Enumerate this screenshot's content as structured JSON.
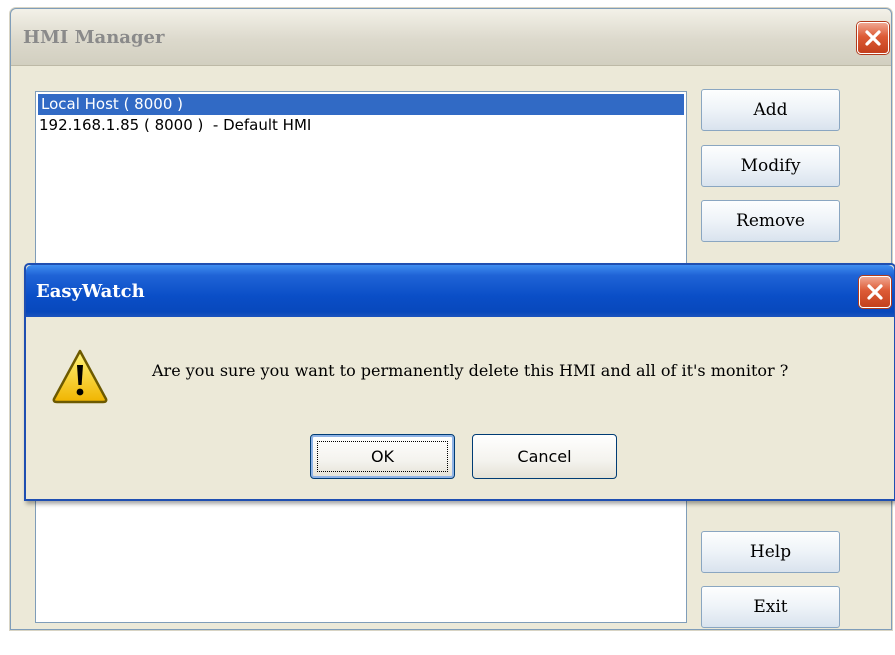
{
  "window": {
    "title": "HMI Manager",
    "close_icon": "close-icon"
  },
  "hmi_list": {
    "items": [
      {
        "label": "Local Host ( 8000 )",
        "selected": true
      },
      {
        "label": "192.168.1.85 ( 8000 )  - Default HMI",
        "selected": false
      }
    ]
  },
  "buttons": {
    "add": "Add",
    "modify": "Modify",
    "remove": "Remove",
    "help": "Help",
    "exit": "Exit"
  },
  "dialog": {
    "title": "EasyWatch",
    "icon": "warning-icon",
    "message": "Are you sure you want to permanently delete this HMI and all of it's monitor ?",
    "ok": "OK",
    "cancel": "Cancel"
  },
  "colors": {
    "selection": "#316ac5",
    "dialog_title": "#0a4ec7",
    "close_button": "#dd5b36",
    "warning_fill": "#ffd800"
  }
}
